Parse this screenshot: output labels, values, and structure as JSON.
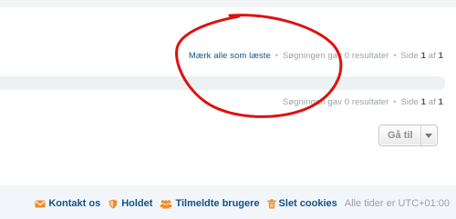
{
  "top_actions": {
    "mark_read": "Mærk alle som læste",
    "result_text": "Søgningen gav 0 resultater",
    "page_prefix": "Side",
    "page_current": "1",
    "page_of": "af",
    "page_total": "1"
  },
  "bottom_actions": {
    "result_text": "Søgningen gav 0 resultater",
    "page_prefix": "Side",
    "page_current": "1",
    "page_of": "af",
    "page_total": "1"
  },
  "jumpbox": {
    "label": "Gå til"
  },
  "footer": {
    "contact": "Kontakt os",
    "team": "Holdet",
    "members": "Tilmeldte brugere",
    "delete_cookies": "Slet cookies",
    "timezone": "Alle tider er UTC+01:00"
  },
  "colors": {
    "link": "#105289",
    "muted": "#9aa0a6",
    "footer_icon": "#f28c28",
    "annotation_red": "#e01010"
  },
  "icons": {
    "contact": "envelope-icon",
    "team": "shield-icon",
    "members": "users-icon",
    "delete_cookies": "trash-icon",
    "jumpbox": "caret-down-icon"
  }
}
